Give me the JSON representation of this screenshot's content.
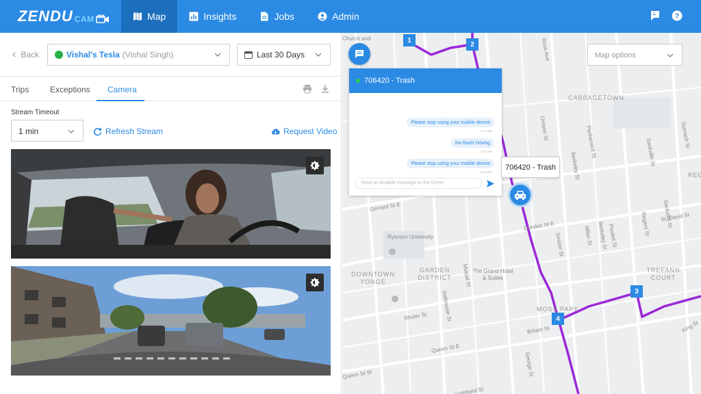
{
  "app": {
    "logo_main": "ZENDU",
    "logo_sub": "CAM"
  },
  "nav": {
    "items": [
      {
        "label": "Map",
        "icon": "map-icon",
        "active": true
      },
      {
        "label": "Insights",
        "icon": "chart-icon",
        "active": false
      },
      {
        "label": "Jobs",
        "icon": "document-icon",
        "active": false
      },
      {
        "label": "Admin",
        "icon": "user-icon",
        "active": false
      }
    ],
    "right_icons": [
      "flag-icon",
      "help-icon"
    ]
  },
  "left": {
    "back_label": "Back",
    "vehicle": {
      "name": "Vishal's Tesla",
      "driver": "(Vishal Singh)",
      "status_color": "#26b04a"
    },
    "date_range": "Last 30 Days",
    "tabs": [
      {
        "label": "Trips",
        "active": false
      },
      {
        "label": "Exceptions",
        "active": false
      },
      {
        "label": "Camera",
        "active": true
      }
    ],
    "stream_timeout_label": "Stream Timeout",
    "stream_timeout_value": "1 min",
    "refresh_label": "Refresh Stream",
    "request_label": "Request Video"
  },
  "map": {
    "options_placeholder": "Map options",
    "waypoints": [
      "1",
      "2",
      "3",
      "4"
    ],
    "streets": [
      "Gerrard St E",
      "Dundas St E",
      "Shuter St",
      "Queen St E",
      "Queen St W",
      "Lombard St",
      "Britain St",
      "Ontario St",
      "Berkeley St",
      "Parliament St",
      "Sackville St",
      "Sumach St",
      "Seaton St",
      "Milan St",
      "Regent St",
      "Sackville St",
      "St. David St",
      "Mutual St",
      "Dalhousie St",
      "George St",
      "Poulett St",
      "Berkeley St",
      "Rose Ave",
      "King St",
      "Church and"
    ],
    "areas": [
      "CABBAGETOWN",
      "GARDEN DISTRICT",
      "DOWNTOWN YONGE",
      "TREFANN COURT",
      "MOSS PARK",
      "REGENT PARK"
    ],
    "places": [
      "Ryerson University",
      "The Grand Hotel & Suites"
    ],
    "route_color": "#9b27d8",
    "chat": {
      "title": "706420 - Trash",
      "messages": [
        {
          "text": "Please stop using your mobile device",
          "time": "10:34 AM"
        },
        {
          "text": "No Rash Driving",
          "time": "10:37 PM"
        },
        {
          "text": "Please stop using your mobile device",
          "time": "10:43 PM"
        }
      ],
      "input_placeholder": "Send an Audible message to the Driver"
    },
    "vehicle_tooltip": "706420 - Trash"
  },
  "colors": {
    "primary": "#2b8ae3",
    "nav_active": "#1c6fbd"
  }
}
